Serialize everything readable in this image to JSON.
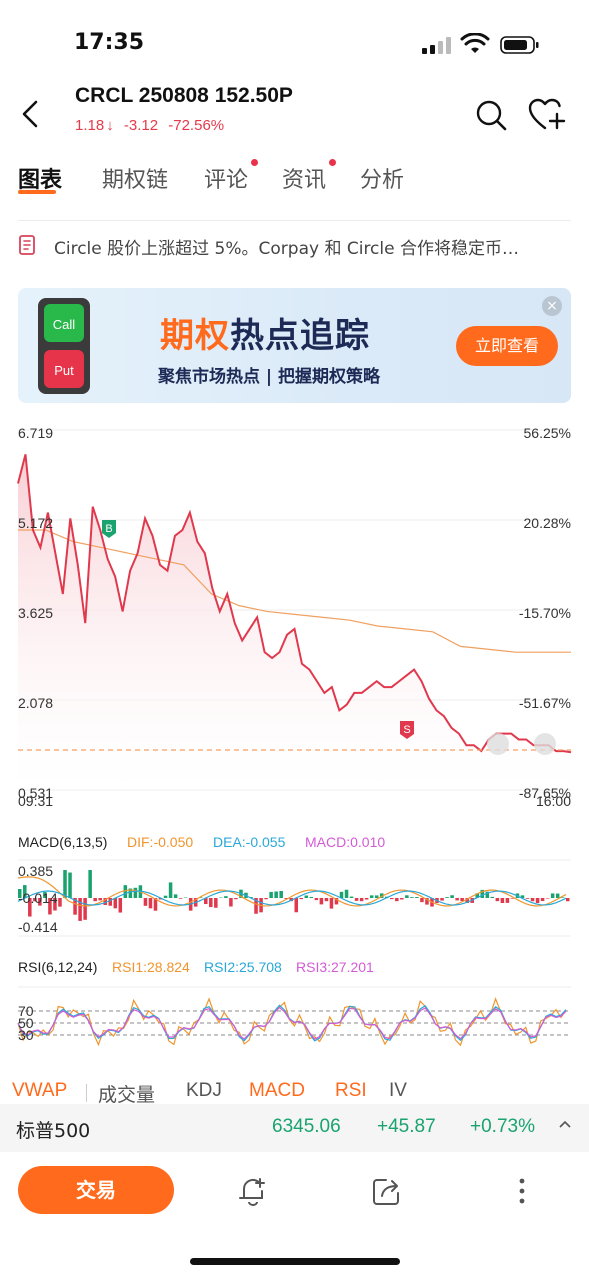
{
  "status": {
    "time": "17:35"
  },
  "header": {
    "title": "CRCL 250808 152.50P",
    "price": "1.18",
    "change": "-3.12",
    "change_pct": "-72.56%",
    "down_color": "#e33b4b"
  },
  "tabs": [
    {
      "label": "图表",
      "active": true
    },
    {
      "label": "期权链"
    },
    {
      "label": "评论",
      "badge": true
    },
    {
      "label": "资讯",
      "badge": true
    },
    {
      "label": "分析"
    }
  ],
  "news": {
    "text": "Circle 股价上涨超过 5%。Corpay 和 Circle 合作将稳定币…"
  },
  "banner": {
    "title_part1": "期权",
    "title_part2": "热点追踪",
    "subtitle": "聚焦市场热点 | 把握期权策略",
    "cta": "立即查看",
    "light_top": "Call",
    "light_bottom": "Put"
  },
  "chart": {
    "left_ticks": [
      "6.719",
      "5.172",
      "3.625",
      "2.078",
      "0.531"
    ],
    "right_ticks": [
      "56.25%",
      "20.28%",
      "-15.70%",
      "-51.67%",
      "-87.65%"
    ],
    "time_start": "09:31",
    "time_end": "16:00",
    "buy_marker": "B",
    "sell_marker": "S",
    "price_color": "#e0394d",
    "vwap_color": "#f0a060"
  },
  "chart_data": {
    "type": "line",
    "title": "",
    "xlabel": "",
    "ylabel": "",
    "ylim": [
      0.531,
      6.719
    ],
    "x_range": [
      "09:31",
      "16:00"
    ],
    "series": [
      {
        "name": "",
        "values": [
          5.8,
          6.3,
          5.0,
          4.7,
          5.3,
          4.6,
          3.9,
          5.2,
          4.4,
          3.4,
          5.4,
          5.0,
          4.5,
          4.2,
          3.6,
          4.3,
          4.6,
          5.2,
          4.9,
          4.4,
          4.3,
          4.9,
          5.0,
          5.3,
          4.8,
          4.6,
          4.0,
          3.6,
          3.9,
          3.4,
          3.1,
          3.3,
          3.5,
          2.9,
          2.8,
          2.9,
          3.2,
          3.3,
          2.7,
          2.6,
          2.4,
          2.2,
          2.3,
          1.9,
          2.0,
          2.2,
          2.2,
          2.3,
          2.4,
          2.3,
          2.3,
          2.4,
          2.5,
          2.6,
          2.4,
          2.1,
          1.9,
          1.8,
          1.6,
          1.5,
          1.3,
          1.3,
          1.2,
          1.4,
          1.5,
          1.5,
          1.5,
          1.4,
          1.4,
          1.3,
          1.3,
          1.3,
          1.2,
          1.2,
          1.18
        ]
      },
      {
        "name": "",
        "values": [
          5.0,
          5.0,
          4.8,
          4.7,
          4.6,
          4.5,
          4.4,
          3.9,
          3.7,
          3.6,
          3.55,
          3.5,
          3.45,
          3.35,
          3.3,
          3.25,
          3.0,
          2.95,
          2.9,
          2.9,
          2.9
        ]
      }
    ]
  },
  "macd": {
    "label": "MACD(6,13,5)",
    "dif": "DIF:-0.050",
    "dea": "DEA:-0.055",
    "macd": "MACD:0.010",
    "ticks": [
      "0.385",
      "-0.014",
      "-0.414"
    ],
    "dif_color": "#f0952e",
    "dea_color": "#2aa8d8",
    "macd_color": "#d45bd6"
  },
  "rsi": {
    "label": "RSI(6,12,24)",
    "rsi1": "RSI1:28.824",
    "rsi2": "RSI2:25.708",
    "rsi3": "RSI3:27.201",
    "ticks": [
      "70",
      "50",
      "30"
    ]
  },
  "indicator_tabs": [
    {
      "label": "VWAP",
      "on": true
    },
    {
      "label": "成交量"
    },
    {
      "label": "KDJ"
    },
    {
      "label": "MACD",
      "on": true
    },
    {
      "label": "RSI",
      "on": true
    },
    {
      "label": "IV"
    }
  ],
  "index": {
    "name": "标普500",
    "value": "6345.06",
    "change": "+45.87",
    "change_pct": "+0.73%",
    "up_color": "#1aa36f"
  },
  "bottom": {
    "trade": "交易"
  }
}
